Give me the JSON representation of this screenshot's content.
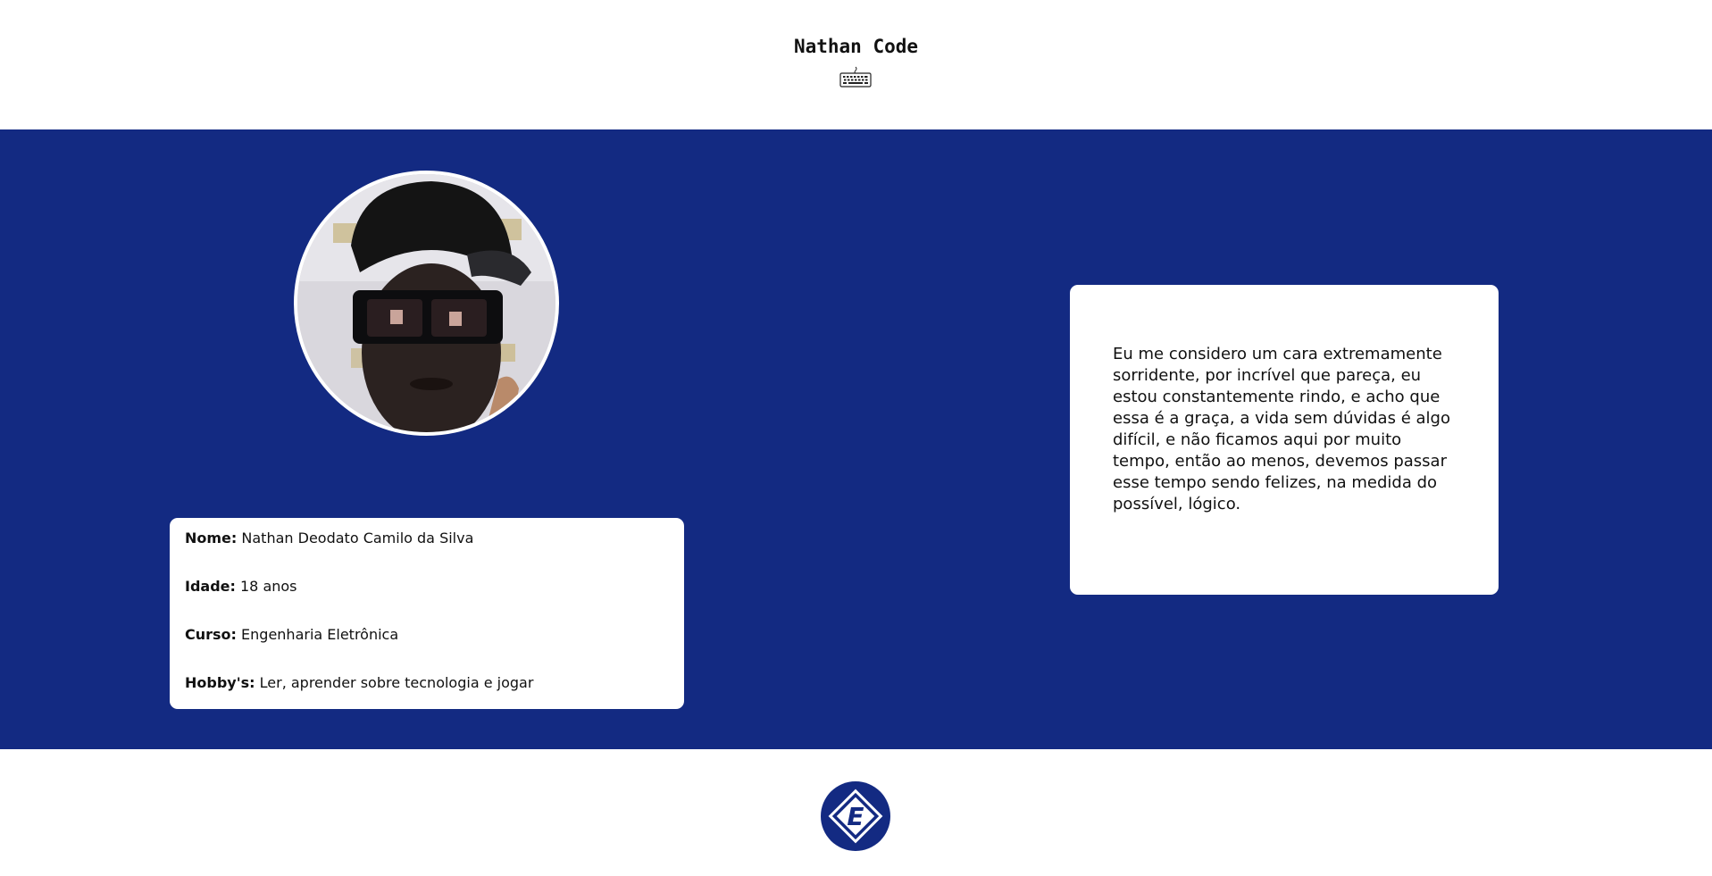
{
  "header": {
    "title": "Nathan Code",
    "icon": "keyboard-icon"
  },
  "profile": {
    "photo_icon": "profile-photo",
    "fields": [
      {
        "key": "Nome:",
        "value": "Nathan Deodato Camilo da Silva"
      },
      {
        "key": "Idade:",
        "value": "18 anos"
      },
      {
        "key": "Curso:",
        "value": "Engenharia Eletrônica"
      },
      {
        "key": "Hobby's:",
        "value": "Ler, aprender sobre tecnologia e jogar"
      }
    ]
  },
  "bio": {
    "text": "Eu me considero um cara extremamente sorridente, por incrível que pareça, eu estou constantemente rindo, e acho que essa é a graça, a vida sem dúvidas é algo difícil, e não ficamos aqui por muito tempo, então ao menos, devemos passar esse tempo sendo felizes, na medida do possível, lógico."
  },
  "footer": {
    "logo_letter": "E",
    "logo_icon": "school-logo-icon"
  },
  "colors": {
    "primary_blue": "#132a82",
    "card_bg": "#ffffff",
    "text": "#111111"
  }
}
